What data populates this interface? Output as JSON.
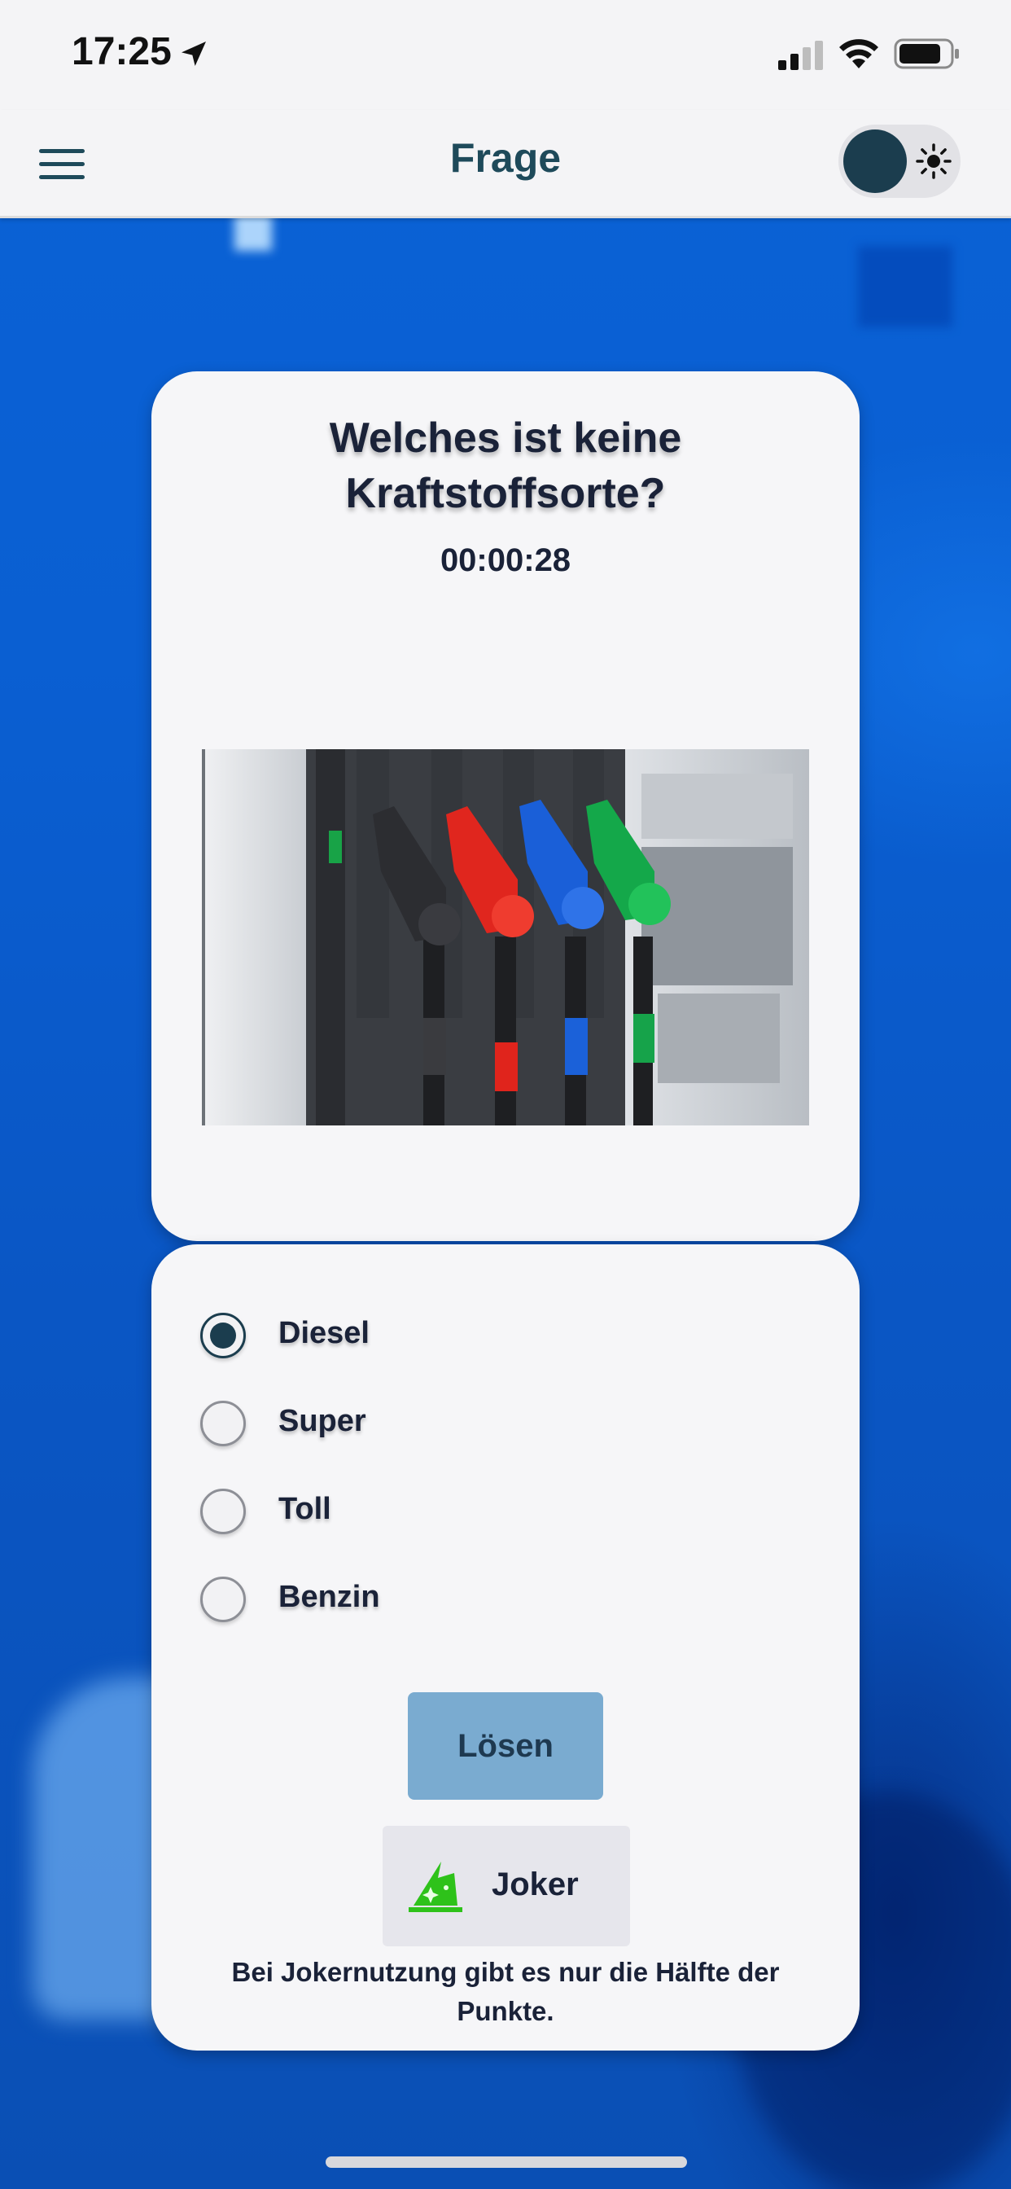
{
  "status_bar": {
    "time": "17:25",
    "icons": [
      "location-arrow-icon",
      "cellular-signal-icon",
      "wifi-icon",
      "battery-icon"
    ]
  },
  "nav": {
    "title": "Frage",
    "menu_icon": "hamburger-menu-icon",
    "theme_toggle_icon": "sun-icon"
  },
  "question": {
    "text": "Welches ist keine Kraftstoffsorte?",
    "timer": "00:00:28",
    "image": "fuel-pump-nozzles-image"
  },
  "options": [
    {
      "label": "Diesel",
      "selected": true
    },
    {
      "label": "Super",
      "selected": false
    },
    {
      "label": "Toll",
      "selected": false
    },
    {
      "label": "Benzin",
      "selected": false
    }
  ],
  "actions": {
    "solve_label": "Lösen",
    "joker_label": "Joker",
    "joker_note": "Bei Jokernutzung gibt es nur die Hälfte der Punkte."
  },
  "colors": {
    "accent": "#1b3d4e",
    "background_blue": "#0a5fd2",
    "card": "#f6f6f8",
    "solve_button": "#7aabd0",
    "joker_icon": "#2ec21a"
  }
}
